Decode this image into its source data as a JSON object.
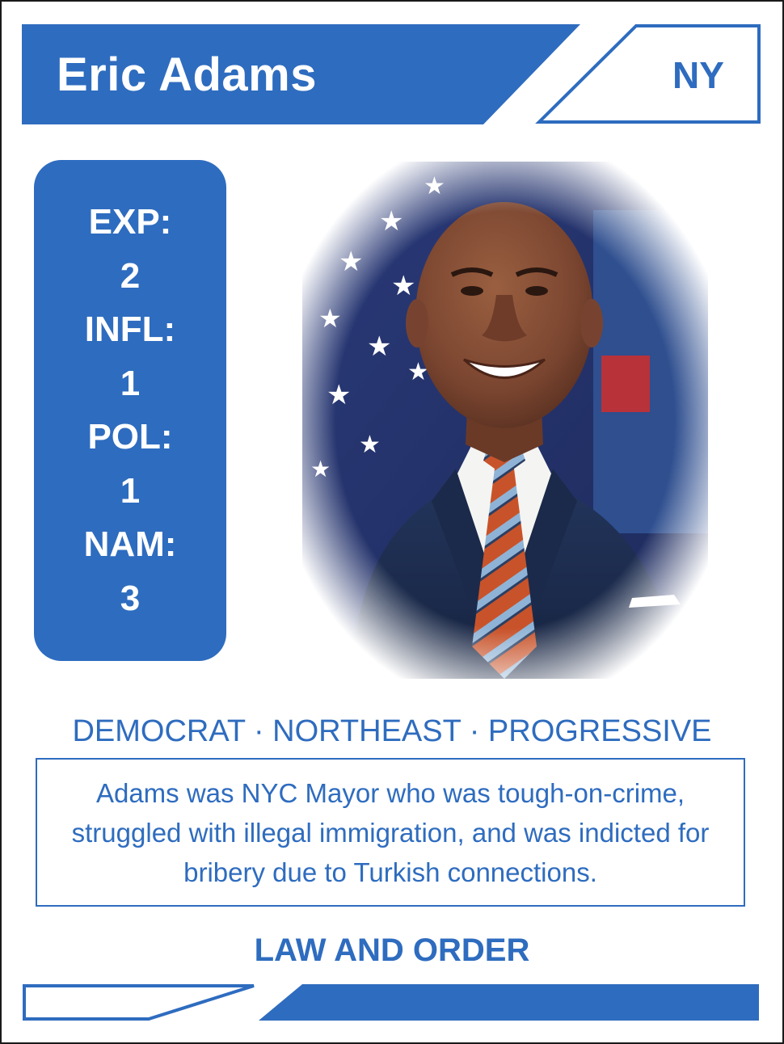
{
  "card": {
    "name": "Eric Adams",
    "state": "NY",
    "stats": [
      {
        "label": "EXP:",
        "value": "2"
      },
      {
        "label": "INFL:",
        "value": "1"
      },
      {
        "label": "POL:",
        "value": "1"
      },
      {
        "label": "NAM:",
        "value": "3"
      }
    ],
    "tags": "DEMOCRAT · NORTHEAST · PROGRESSIVE",
    "bio": "Adams was NYC Mayor who was tough-on-crime, struggled with illegal immigration, and was indicted for bribery due to Turkish connections.",
    "theme": "LAW AND ORDER"
  },
  "photo": {
    "subject": "portrait-of-eric-adams"
  },
  "colors": {
    "accent": "#2e6cbf",
    "background": "#ffffff",
    "text_on_accent": "#ffffff"
  }
}
